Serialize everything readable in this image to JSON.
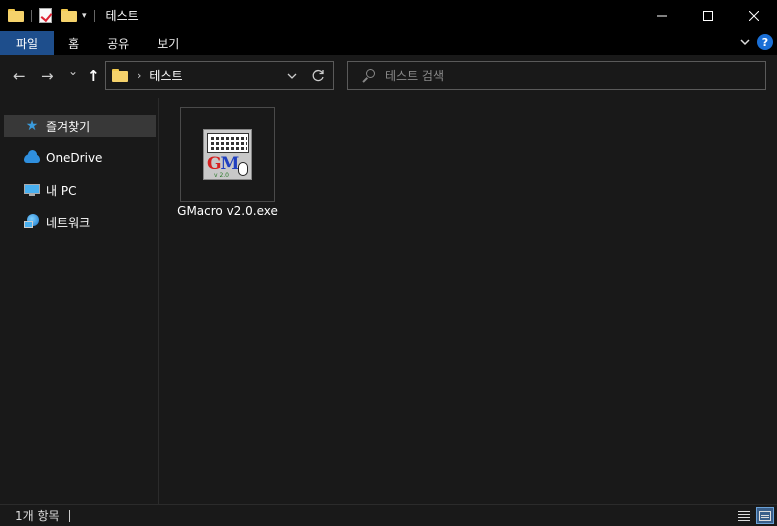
{
  "window": {
    "title": "테스트",
    "minimize": "—",
    "maximize": "☐",
    "close": "✕"
  },
  "ribbon": {
    "tabs": [
      "파일",
      "홈",
      "공유",
      "보기"
    ],
    "help": "?"
  },
  "nav": {
    "back": "←",
    "forward": "→",
    "recent": "⌄",
    "up": "↑",
    "breadcrumb": "테스트",
    "search_placeholder": "테스트 검색"
  },
  "sidebar": {
    "items": [
      {
        "label": "즐겨찾기",
        "icon": "star-icon"
      },
      {
        "label": "OneDrive",
        "icon": "cloud-icon"
      },
      {
        "label": "내 PC",
        "icon": "pc-icon"
      },
      {
        "label": "네트워크",
        "icon": "network-icon"
      }
    ]
  },
  "files": [
    {
      "name": "GMacro v2.0.exe",
      "icon_text_g": "G",
      "icon_text_m": "M",
      "icon_version": "v 2.0"
    }
  ],
  "status": {
    "count": "1개 항목"
  },
  "colors": {
    "accent": "#1e4e8c",
    "background": "#191919",
    "titlebar": "#000000"
  }
}
